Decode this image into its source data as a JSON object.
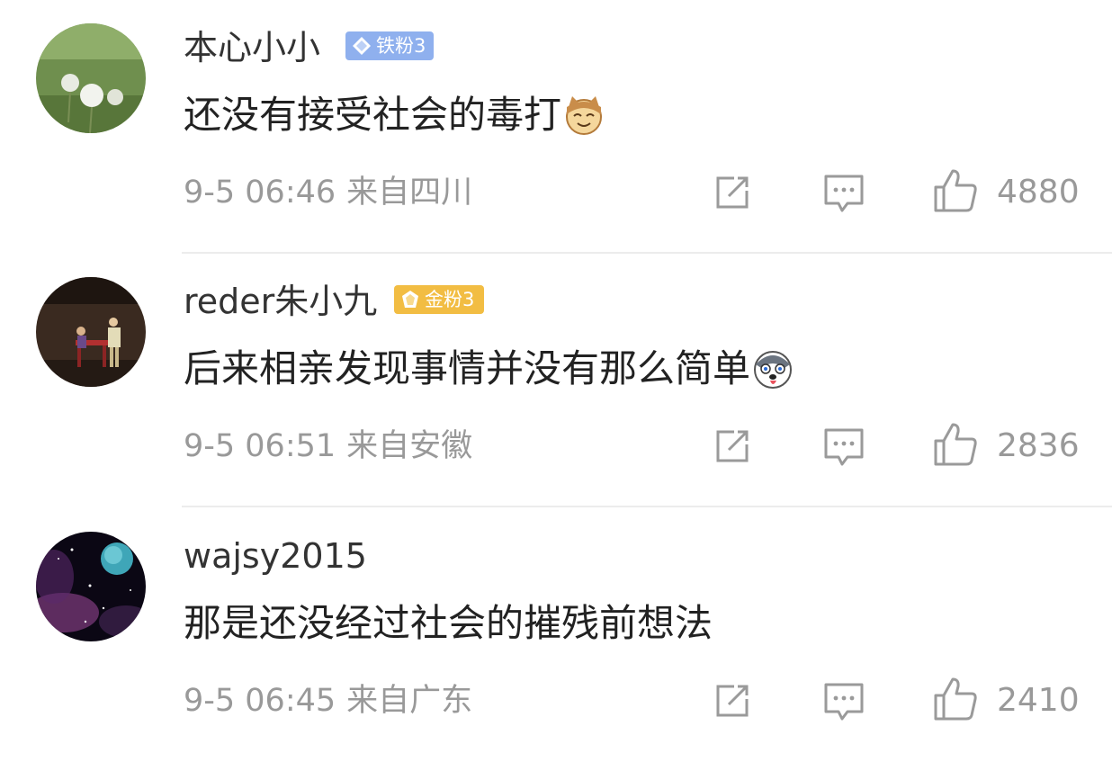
{
  "comments": [
    {
      "username": "本心小小",
      "badge": {
        "type": "iron",
        "label": "铁粉3",
        "color": "#8fb0ee"
      },
      "text": "还没有接受社会的毒打",
      "emoji_icon": "cat-face-emoji-icon",
      "time": "9-5 06:46",
      "location": "来自四川",
      "likes": "4880"
    },
    {
      "username": "reder朱小九",
      "badge": {
        "type": "gold",
        "label": "金粉3",
        "color": "#f2bd43"
      },
      "text": "后来相亲发现事情并没有那么简单",
      "emoji_icon": "husky-face-emoji-icon",
      "time": "9-5 06:51",
      "location": "来自安徽",
      "likes": "2836"
    },
    {
      "username": "wajsy2015",
      "badge": null,
      "text": "那是还没经过社会的摧残前想法",
      "emoji_icon": null,
      "time": "9-5 06:45",
      "location": "来自广东",
      "likes": "2410"
    }
  ],
  "icons": {
    "share": "share-icon",
    "reply": "comment-icon",
    "like": "thumbs-up-icon"
  },
  "colors": {
    "meta_text": "#999999",
    "main_text": "#222222",
    "divider": "#ececec"
  }
}
